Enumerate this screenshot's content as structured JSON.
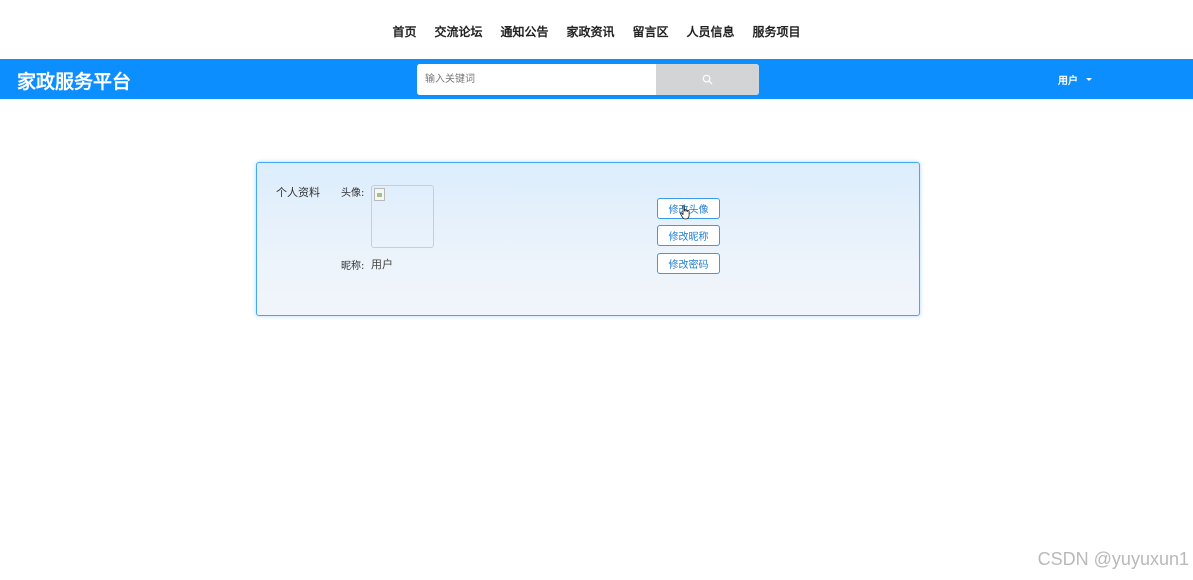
{
  "topnav": {
    "items": [
      "首页",
      "交流论坛",
      "通知公告",
      "家政资讯",
      "留言区",
      "人员信息",
      "服务项目"
    ]
  },
  "header": {
    "brand": "家政服务平台",
    "search_placeholder": "输入关键词",
    "search_icon": "search-icon",
    "user_label": "用户",
    "accent_color": "#0d8eff"
  },
  "profile": {
    "title": "个人资料",
    "avatar_label": "头像:",
    "nickname_label": "昵称:",
    "nickname_value": "用户",
    "buttons": {
      "change_avatar": "修改头像",
      "change_nickname": "修改昵称",
      "change_password": "修改密码"
    }
  },
  "watermark": "CSDN @yuyuxun1"
}
